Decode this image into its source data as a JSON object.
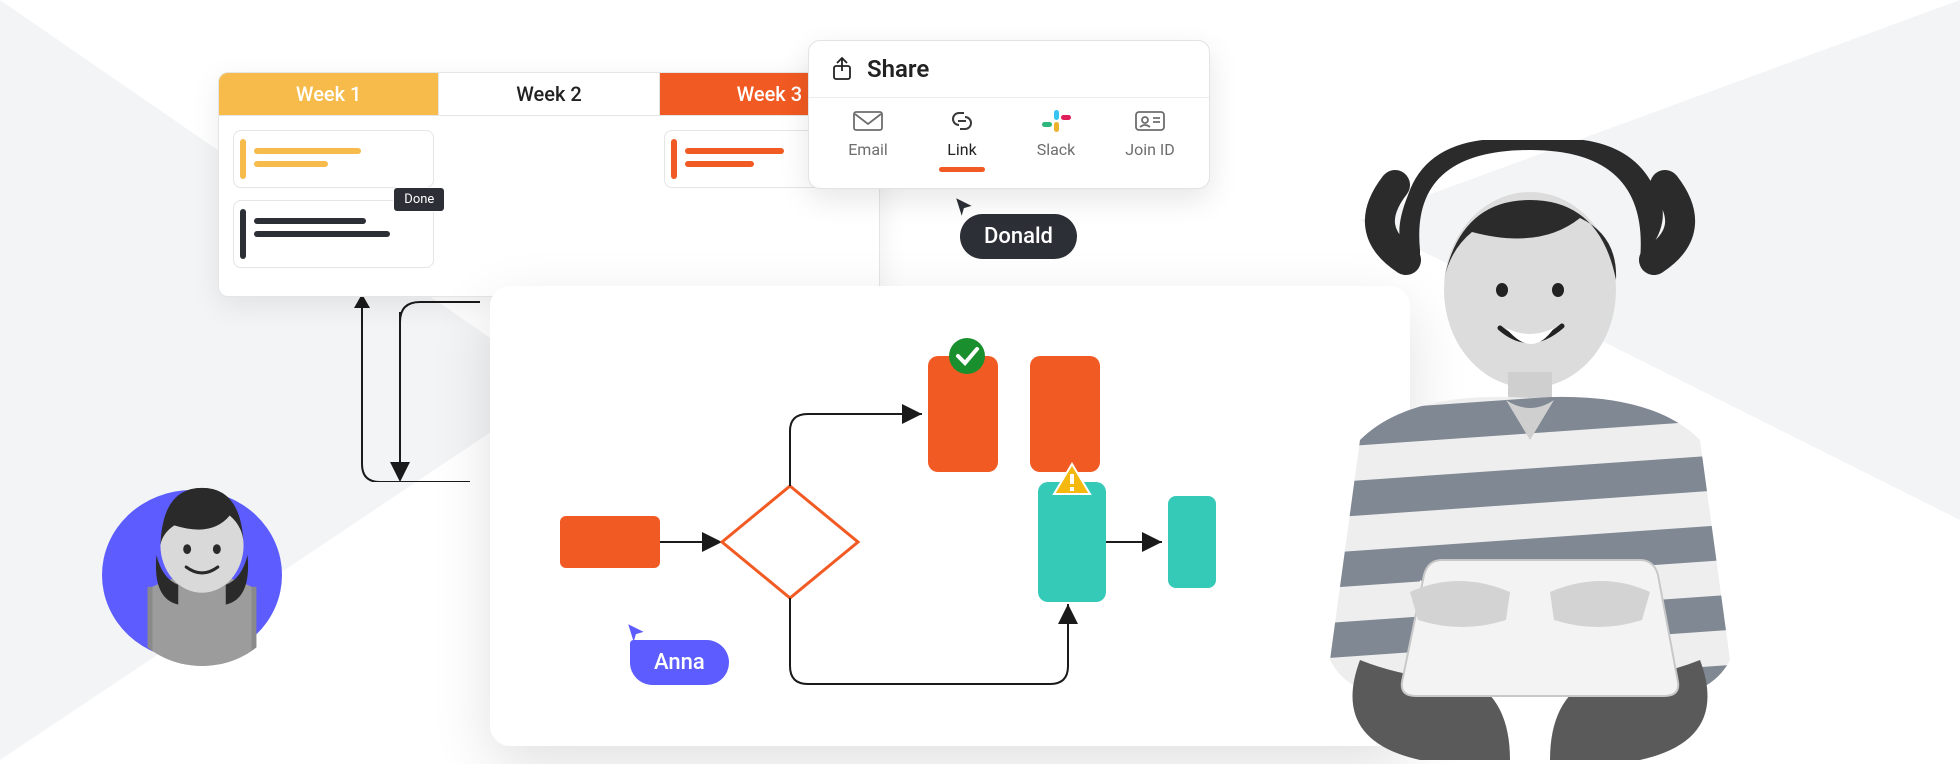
{
  "board": {
    "tabs": [
      "Week 1",
      "Week 2",
      "Week 3"
    ],
    "done_label": "Done",
    "colors": {
      "week1": "#f6bb4a",
      "week3": "#f15a22",
      "dark": "#2c2f36"
    }
  },
  "share": {
    "title": "Share",
    "items": [
      {
        "label": "Email",
        "active": false
      },
      {
        "label": "Link",
        "active": true
      },
      {
        "label": "Slack",
        "active": false
      },
      {
        "label": "Join ID",
        "active": false
      }
    ]
  },
  "cursors": {
    "donald": "Donald",
    "anna": "Anna"
  }
}
